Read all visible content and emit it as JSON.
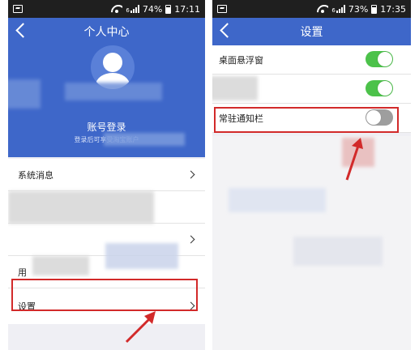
{
  "left_screen": {
    "status": {
      "battery_text": "74%",
      "time": "17:11",
      "network": "6"
    },
    "nav": {
      "title": "个人中心"
    },
    "profile": {
      "login_title": "账号登录",
      "login_sub": "登录后可享受淘宝账户"
    },
    "menu": {
      "items": [
        {
          "label": "系统消息"
        },
        {
          "label": ""
        },
        {
          "label": ""
        },
        {
          "label": "用"
        },
        {
          "label": "设置"
        }
      ]
    }
  },
  "right_screen": {
    "status": {
      "battery_text": "73%",
      "time": "17:35",
      "network": "6"
    },
    "nav": {
      "title": "设置"
    },
    "settings": [
      {
        "label": "桌面悬浮窗",
        "enabled": true
      },
      {
        "label": "",
        "enabled": true
      },
      {
        "label": "常驻通知栏",
        "enabled": false
      }
    ]
  },
  "colors": {
    "header_blue": "#3e67c9",
    "status_bar": "#1f1f1f",
    "toggle_on": "#4cc24a",
    "toggle_off": "#9e9e9e",
    "highlight_red": "#d22a2a"
  }
}
